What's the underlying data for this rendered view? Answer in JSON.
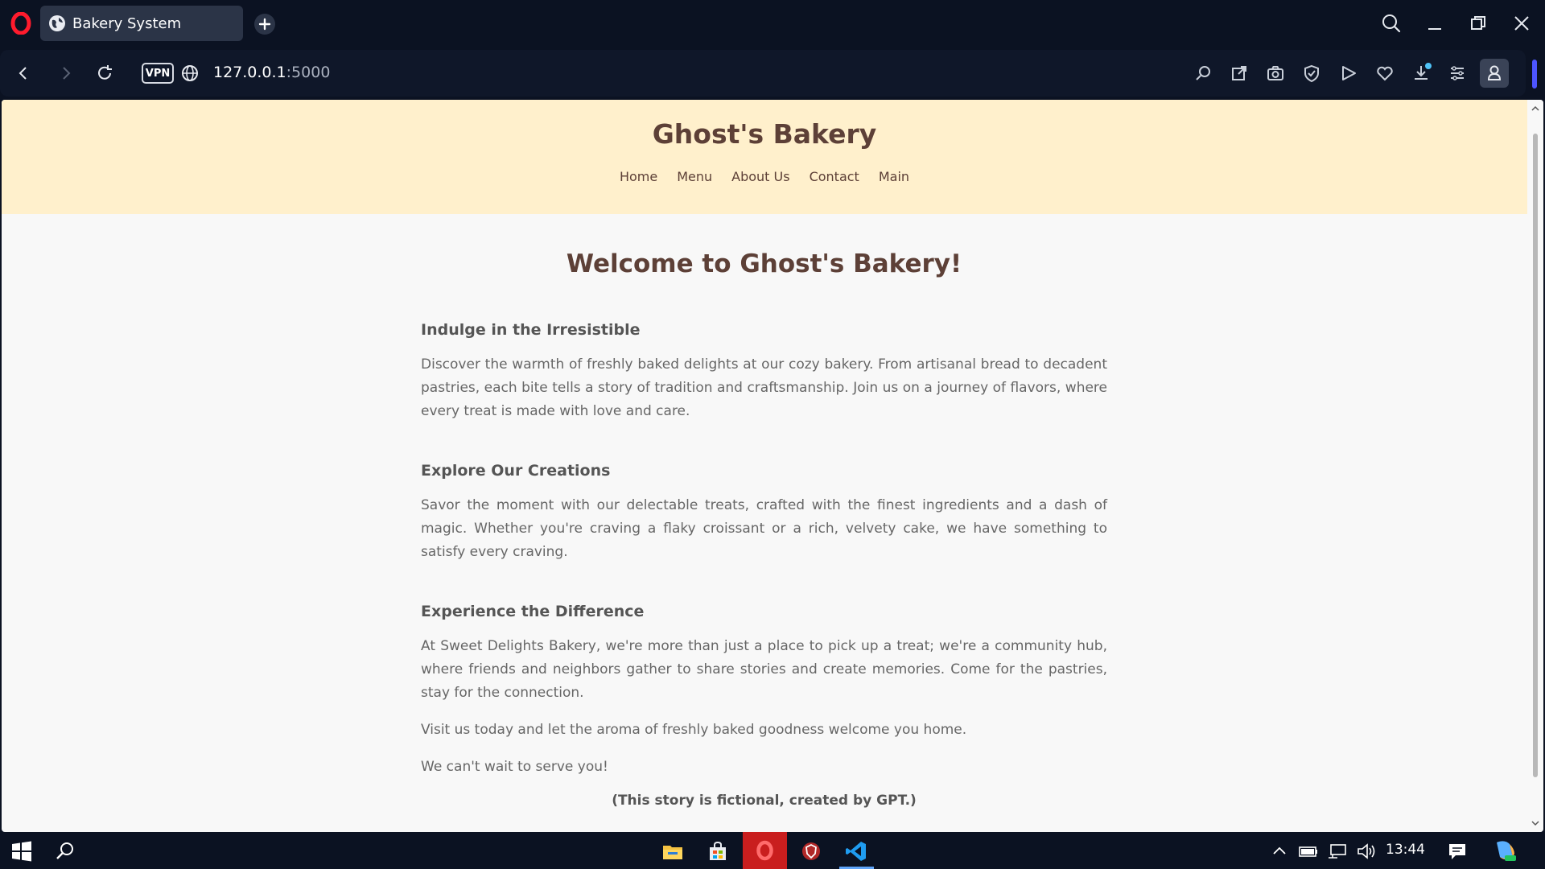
{
  "browser": {
    "tab_title": "Bakery System",
    "url_host": "127.0.0.1",
    "url_port": ":5000",
    "vpn_label": "VPN",
    "accent_color": "#4d55ff"
  },
  "site": {
    "title": "Ghost's Bakery",
    "nav": [
      "Home",
      "Menu",
      "About Us",
      "Contact",
      "Main"
    ],
    "welcome": "Welcome to Ghost's Bakery!",
    "sections": [
      {
        "heading": "Indulge in the Irresistible",
        "paragraphs": [
          "Discover the warmth of freshly baked delights at our cozy bakery. From artisanal bread to decadent pastries, each bite tells a story of tradition and craftsmanship. Join us on a journey of flavors, where every treat is made with love and care."
        ]
      },
      {
        "heading": "Explore Our Creations",
        "paragraphs": [
          "Savor the moment with our delectable treats, crafted with the finest ingredients and a dash of magic. Whether you're craving a flaky croissant or a rich, velvety cake, we have something to satisfy every craving."
        ]
      },
      {
        "heading": "Experience the Difference",
        "paragraphs": [
          "At Sweet Delights Bakery, we're more than just a place to pick up a treat; we're a community hub, where friends and neighbors gather to share stories and create memories. Come for the pastries, stay for the connection.",
          "Visit us today and let the aroma of freshly baked goodness welcome you home.",
          "We can't wait to serve you!"
        ]
      }
    ],
    "note": "(This story is fictional, created by GPT.)",
    "header_bg": "#fff0cc",
    "brand_color": "#5d4037"
  },
  "taskbar": {
    "time": "13:44"
  }
}
